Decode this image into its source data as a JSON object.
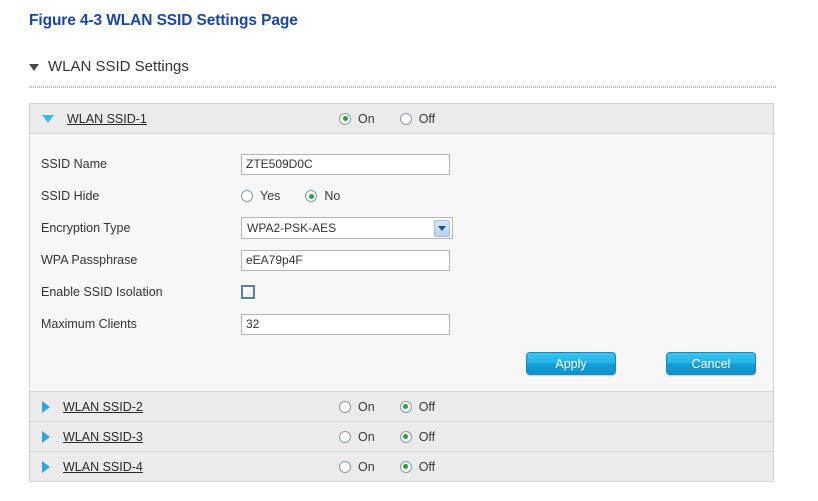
{
  "figure": {
    "caption": "Figure 4-3 WLAN SSID Settings Page"
  },
  "section": {
    "title": "WLAN SSID Settings",
    "caret_icon": "triangle-down-icon"
  },
  "panel": {
    "ssid_items": [
      {
        "name": "WLAN SSID-1",
        "caret_icon": "triangle-down-icon",
        "expanded": true,
        "power": {
          "on_label": "On",
          "off_label": "Off",
          "selected": "On"
        },
        "fields": {
          "ssid_name": {
            "label": "SSID Name",
            "value": "ZTE509D0C"
          },
          "ssid_hide": {
            "label": "SSID Hide",
            "yes_label": "Yes",
            "no_label": "No",
            "selected": "No"
          },
          "encryption_type": {
            "label": "Encryption Type",
            "value": "WPA2-PSK-AES",
            "arrow_icon": "chevron-down-icon"
          },
          "wpa_passphrase": {
            "label": "WPA Passphrase",
            "value": "eEA79p4F"
          },
          "ssid_isolation": {
            "label": "Enable SSID Isolation",
            "checked": false
          },
          "maximum_clients": {
            "label": "Maximum Clients",
            "value": "32"
          }
        },
        "buttons": {
          "apply_label": "Apply",
          "cancel_label": "Cancel"
        }
      },
      {
        "name": "WLAN SSID-2",
        "caret_icon": "triangle-right-icon",
        "expanded": false,
        "power": {
          "on_label": "On",
          "off_label": "Off",
          "selected": "Off"
        }
      },
      {
        "name": "WLAN SSID-3",
        "caret_icon": "triangle-right-icon",
        "expanded": false,
        "power": {
          "on_label": "On",
          "off_label": "Off",
          "selected": "Off"
        }
      },
      {
        "name": "WLAN SSID-4",
        "caret_icon": "triangle-right-icon",
        "expanded": false,
        "power": {
          "on_label": "On",
          "off_label": "Off",
          "selected": "Off"
        }
      }
    ]
  },
  "colors": {
    "title_blue": "#1b46a8",
    "caret_blue": "#39b7e8",
    "radio_dot_green": "#23a537",
    "button_blue": "#26b3e8",
    "header_gray": "#ebebeb"
  }
}
